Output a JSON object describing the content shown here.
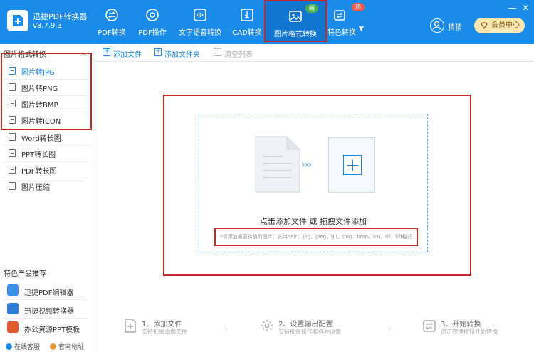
{
  "app": {
    "name": "迅捷PDF转换器",
    "version": "v8.7.9.3"
  },
  "nav": [
    {
      "label": "PDF转换",
      "icon": "pdf-convert-icon"
    },
    {
      "label": "PDF操作",
      "icon": "pdf-operate-icon"
    },
    {
      "label": "文字语音转换",
      "icon": "audio-wave-icon"
    },
    {
      "label": "CAD转换",
      "icon": "cad-icon"
    },
    {
      "label": "图片格式转换",
      "icon": "image-icon",
      "badge": "新"
    },
    {
      "label": "特色转换",
      "icon": "feature-convert-icon",
      "badge": "热"
    }
  ],
  "user": {
    "name": "猜猜"
  },
  "member": {
    "label": "会员中心"
  },
  "window": {
    "minimize": "—",
    "close": "✕"
  },
  "sidebar": {
    "group_title": "图片格式转换",
    "items": [
      {
        "label": "图片转JPG"
      },
      {
        "label": "图片转PNG"
      },
      {
        "label": "图片转BMP"
      },
      {
        "label": "图片转ICON"
      },
      {
        "label": "Word转长图"
      },
      {
        "label": "PPT转长图"
      },
      {
        "label": "PDF转长图"
      },
      {
        "label": "图片压缩"
      }
    ],
    "recommend_title": "特色产品推荐",
    "recommend": [
      {
        "label": "迅捷PDF编辑器",
        "color": "#3a8ee6"
      },
      {
        "label": "迅捷视频转换器",
        "color": "#2e7ed8"
      },
      {
        "label": "办公资源PPT模板",
        "color": "#e05a2b"
      }
    ],
    "footer": [
      {
        "label": "在线客服"
      },
      {
        "label": "官网地址"
      }
    ]
  },
  "toolbar": {
    "add_file": "添加文件",
    "add_folder": "添加文件夹",
    "clear_list": "清空列表"
  },
  "dropzone": {
    "main_text": "点击添加文件 或 拖拽文件添加",
    "hint": "*请添加需要转换的图片，支持heic，jpg，jpeg，gif，png，bmp，ico，tif，tiff格式"
  },
  "steps": [
    {
      "title": "1、添加文件",
      "sub": "支持批量添加文件",
      "icon": "add-file-icon"
    },
    {
      "title": "2、设置输出配置",
      "sub": "支持批量操作和各种设置",
      "icon": "settings-gear-icon"
    },
    {
      "title": "3、开始转换",
      "sub": "点击转换按钮开始转换",
      "icon": "convert-icon"
    }
  ]
}
